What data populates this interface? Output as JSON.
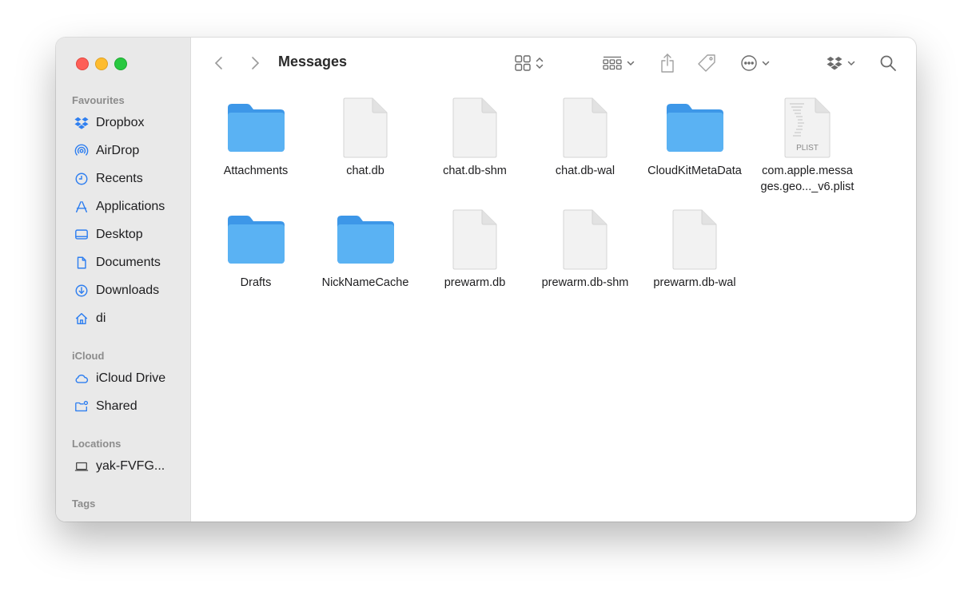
{
  "window": {
    "title": "Messages"
  },
  "sidebar": {
    "favourites_title": "Favourites",
    "favourites": [
      {
        "label": "Dropbox",
        "icon": "dropbox-icon"
      },
      {
        "label": "AirDrop",
        "icon": "airdrop-icon"
      },
      {
        "label": "Recents",
        "icon": "clock-icon"
      },
      {
        "label": "Applications",
        "icon": "applications-icon"
      },
      {
        "label": "Desktop",
        "icon": "desktop-icon"
      },
      {
        "label": "Documents",
        "icon": "document-icon"
      },
      {
        "label": "Downloads",
        "icon": "download-icon"
      },
      {
        "label": "di",
        "icon": "home-icon"
      }
    ],
    "icloud_title": "iCloud",
    "icloud": [
      {
        "label": "iCloud Drive",
        "icon": "cloud-icon"
      },
      {
        "label": "Shared",
        "icon": "shared-folder-icon"
      }
    ],
    "locations_title": "Locations",
    "locations": [
      {
        "label": "yak-FVFG...",
        "icon": "laptop-icon"
      }
    ],
    "tags_title": "Tags"
  },
  "files": [
    {
      "name": "Attachments",
      "kind": "folder"
    },
    {
      "name": "chat.db",
      "kind": "document"
    },
    {
      "name": "chat.db-shm",
      "kind": "document"
    },
    {
      "name": "chat.db-wal",
      "kind": "document"
    },
    {
      "name": "CloudKitMetaData",
      "kind": "folder"
    },
    {
      "name": "com.apple.messa\nges.geo..._v6.plist",
      "kind": "plist",
      "badge": "PLIST"
    },
    {
      "name": "Drafts",
      "kind": "folder"
    },
    {
      "name": "NickNameCache",
      "kind": "folder"
    },
    {
      "name": "prewarm.db",
      "kind": "document"
    },
    {
      "name": "prewarm.db-shm",
      "kind": "document"
    },
    {
      "name": "prewarm.db-wal",
      "kind": "document"
    }
  ],
  "colors": {
    "accent": "#2f7ff0",
    "folder": "#5ab2f3"
  }
}
